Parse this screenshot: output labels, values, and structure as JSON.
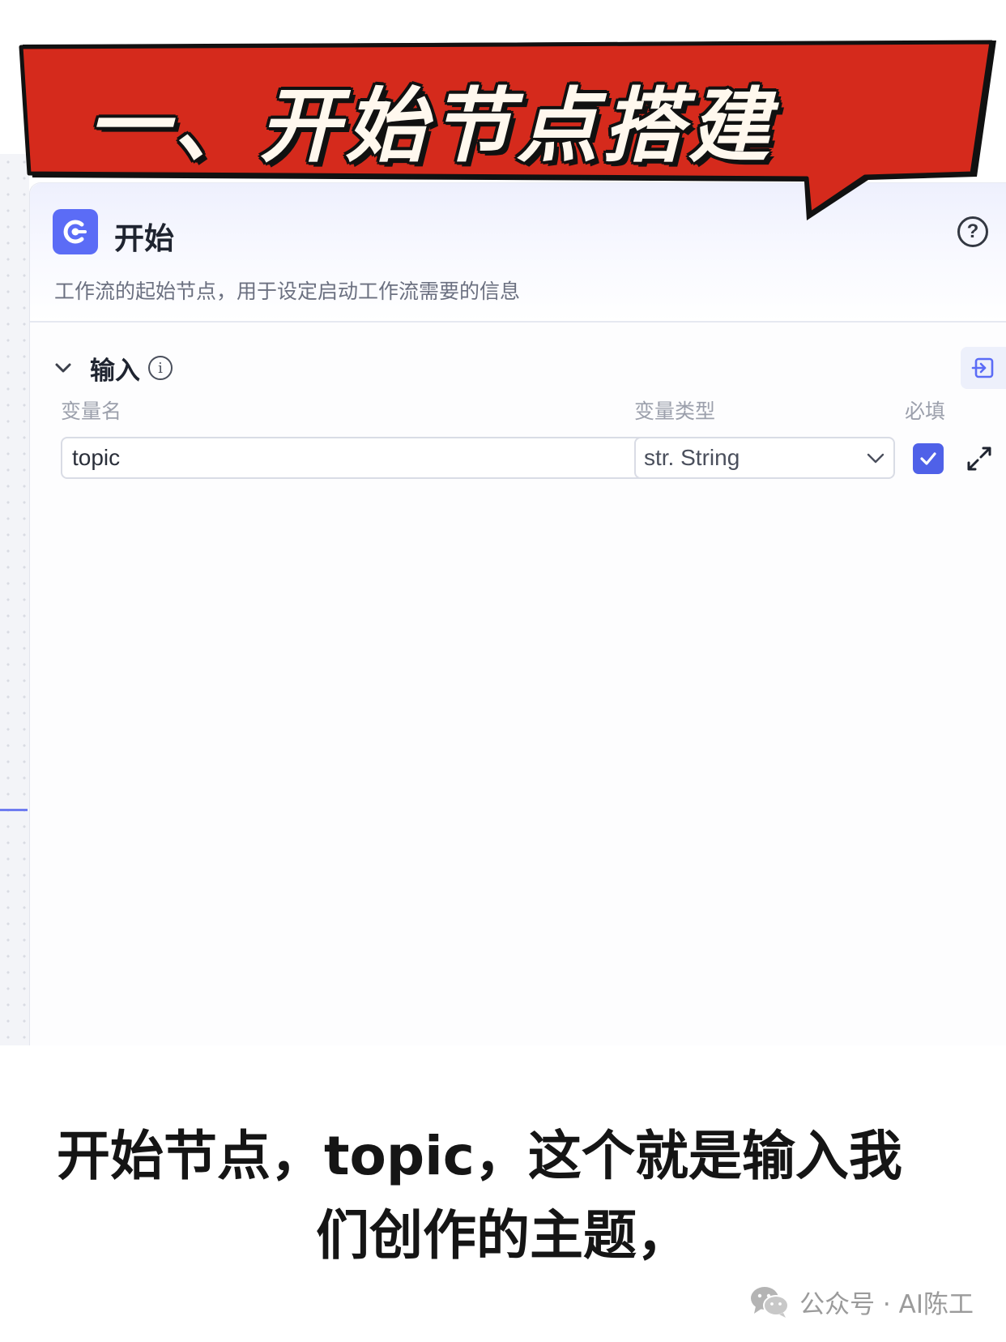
{
  "banner": {
    "title": "一、开始节点搭建"
  },
  "node": {
    "title": "开始",
    "description": "工作流的起始节点，用于设定启动工作流需要的信息",
    "help": "?"
  },
  "inputs": {
    "section_title": "输入",
    "info": "i",
    "columns": {
      "name": "变量名",
      "type": "变量类型",
      "required": "必填"
    },
    "rows": [
      {
        "name": "topic",
        "type": "str. String",
        "required": true
      }
    ]
  },
  "caption": {
    "line1": "开始节点，topic，这个就是输入我",
    "line2": "们创作的主题，"
  },
  "watermark": {
    "text": "公众号 · AI陈工"
  },
  "colors": {
    "banner_red": "#d52a1c",
    "accent_blue": "#5b6cf6",
    "checkbox_blue": "#4f61e8"
  }
}
